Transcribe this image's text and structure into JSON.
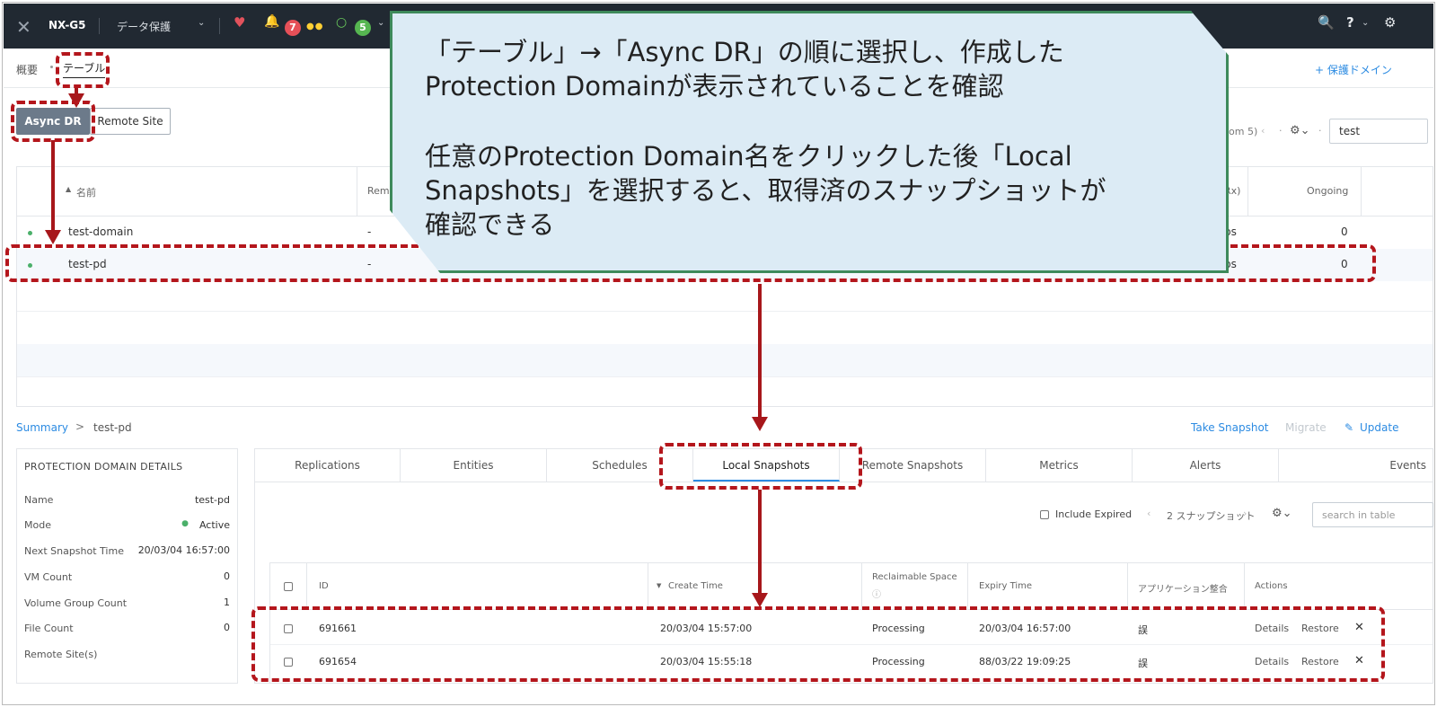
{
  "topbar": {
    "cluster_name": "NX-G5",
    "section": "データ保護",
    "alert_count": "7",
    "task_count": "5"
  },
  "subnav": {
    "overview": "概要",
    "table": "テーブル",
    "add_protection_domain": "+ 保護ドメイン"
  },
  "view_buttons": {
    "async_dr": "Async DR",
    "remote_site": "Remote Site"
  },
  "toolbar": {
    "count_text": "om 5)",
    "search_value": "test"
  },
  "pd_table": {
    "headers": {
      "name": "名前",
      "remote": "Remo",
      "rx": "Rx)",
      "ongoing": "Ongoing"
    },
    "rows": [
      {
        "name": "test-domain",
        "remote": "-",
        "rx": "ps",
        "ongoing": "0"
      },
      {
        "name": "test-pd",
        "remote": "-",
        "rx": "ps",
        "ongoing": "0"
      }
    ]
  },
  "summary_bar": {
    "summary": "Summary",
    "chevron": ">",
    "selected": "test-pd",
    "take_snapshot": "Take Snapshot",
    "migrate": "Migrate",
    "update": "Update"
  },
  "details": {
    "title": "PROTECTION DOMAIN DETAILS",
    "fields": [
      {
        "label": "Name",
        "value": "test-pd"
      },
      {
        "label": "Mode",
        "value": "Active"
      },
      {
        "label": "Next Snapshot Time",
        "value": "20/03/04 16:57:00"
      },
      {
        "label": "VM Count",
        "value": "0"
      },
      {
        "label": "Volume Group Count",
        "value": "1"
      },
      {
        "label": "File Count",
        "value": "0"
      },
      {
        "label": "Remote Site(s)",
        "value": ""
      }
    ]
  },
  "tabs": [
    "Replications",
    "Entities",
    "Schedules",
    "Local Snapshots",
    "Remote Snapshots",
    "Metrics",
    "Alerts",
    "Events"
  ],
  "snap_toolbar": {
    "include_expired": "Include Expired",
    "snapshot_count": "2 スナップショット",
    "search_placeholder": "search in table"
  },
  "snap_table": {
    "headers": {
      "id": "ID",
      "create_time": "Create Time",
      "reclaimable": "Reclaimable Space",
      "expiry": "Expiry Time",
      "app_consistent": "アプリケーション整合",
      "actions": "Actions"
    },
    "rows": [
      {
        "id": "691661",
        "create_time": "20/03/04 15:57:00",
        "reclaimable": "Processing",
        "expiry": "20/03/04 16:57:00",
        "app": "誤",
        "details": "Details",
        "restore": "Restore"
      },
      {
        "id": "691654",
        "create_time": "20/03/04 15:55:18",
        "reclaimable": "Processing",
        "expiry": "88/03/22 19:09:25",
        "app": "誤",
        "details": "Details",
        "restore": "Restore"
      }
    ]
  },
  "callout": {
    "line1": "「テーブル」→「Async DR」の順に選択し、作成した",
    "line2": "Protection Domainが表示されていることを確認",
    "line3": "任意のProtection Domain名をクリックした後「Local",
    "line4": "Snapshots」を選択すると、取得済のスナップショットが",
    "line5": "確認できる"
  },
  "colors": {
    "topbar": "#212932",
    "accent_blue": "#2c8be2",
    "callout_bg": "#dcebf5",
    "callout_border": "#3e8a5b",
    "annotation_red": "#b4161c"
  }
}
